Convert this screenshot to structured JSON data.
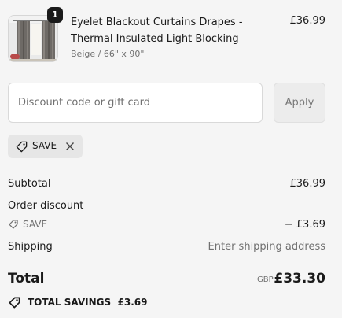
{
  "product": {
    "title": "Eyelet Blackout Curtains Drapes - Thermal Insulated Light Blocking",
    "variant": "Beige / 66\" x 90\"",
    "price": "£36.99",
    "quantity": "1",
    "image_icon": "curtain-thumbnail"
  },
  "discount": {
    "placeholder": "Discount code or gift card",
    "value": "",
    "apply_label": "Apply",
    "applied_code": "SAVE"
  },
  "summary": {
    "subtotal_label": "Subtotal",
    "subtotal_value": "£36.99",
    "order_discount_label": "Order discount",
    "discount_code": "SAVE",
    "discount_value": "− £3.69",
    "shipping_label": "Shipping",
    "shipping_value": "Enter shipping address",
    "total_label": "Total",
    "total_currency": "GBP",
    "total_value": "£33.30",
    "savings_label": "TOTAL SAVINGS  £3.69"
  },
  "colors": {
    "text": "#1a1a1a",
    "muted": "#707070",
    "background": "#f5f5f5"
  }
}
